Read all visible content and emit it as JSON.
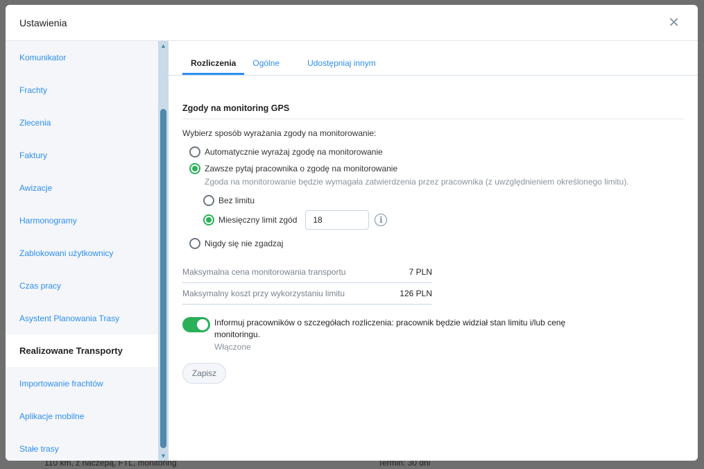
{
  "background": {
    "left_text": "110 km, z naczepą, FTL, monitoring",
    "right_label": "Termin:",
    "right_value": "30 dni"
  },
  "modal": {
    "title": "Ustawienia",
    "close_icon": "close-icon"
  },
  "sidebar": {
    "items": [
      {
        "label": "Komunikator"
      },
      {
        "label": "Frachty"
      },
      {
        "label": "Zlecenia"
      },
      {
        "label": "Faktury"
      },
      {
        "label": "Awizacje"
      },
      {
        "label": "Harmonogramy"
      },
      {
        "label": "Zablokowani użytkownicy"
      },
      {
        "label": "Czas pracy"
      },
      {
        "label": "Asystent Planowania Trasy"
      },
      {
        "label": "Realizowane Transporty",
        "active": true
      },
      {
        "label": "Importowanie frachtów"
      },
      {
        "label": "Aplikacje mobilne"
      },
      {
        "label": "Stałe trasy"
      }
    ]
  },
  "tabs": [
    {
      "label": "Rozliczenia",
      "active": true
    },
    {
      "label": "Ogólne"
    },
    {
      "label": "Udostępniaj innym"
    }
  ],
  "section": {
    "title": "Zgody na monitoring GPS",
    "lead": "Wybierz sposób wyrażania zgody na monitorowanie:",
    "options": {
      "auto": {
        "label": "Automatycznie wyrażaj zgodę na monitorowanie",
        "checked": false
      },
      "ask": {
        "label": "Zawsze pytaj pracownika o zgodę na monitorowanie",
        "checked": true,
        "hint": "Zgoda na monitorowanie będzie wymagała zatwierdzenia przez pracownika (z uwzględnieniem określonego limitu)."
      },
      "nolimit": {
        "label": "Bez limitu",
        "checked": false
      },
      "monthly": {
        "label": "Miesięczny limit zgód",
        "checked": true,
        "value": "18"
      },
      "never": {
        "label": "Nigdy się nie zgadzaj",
        "checked": false
      }
    },
    "rows": [
      {
        "label": "Maksymalna cena monitorowania transportu",
        "value": "7 PLN"
      },
      {
        "label": "Maksymalny koszt przy wykorzystaniu limitu",
        "value": "126 PLN"
      }
    ],
    "toggle": {
      "label": "Informuj pracowników o szczegółach rozliczenia: pracownik będzie widział stan limitu i/lub cenę monitoringu.",
      "status": "Włączone",
      "on": true
    },
    "save_label": "Zapisz"
  },
  "colors": {
    "accent": "#2e8ef0",
    "success": "#2bb05a"
  }
}
